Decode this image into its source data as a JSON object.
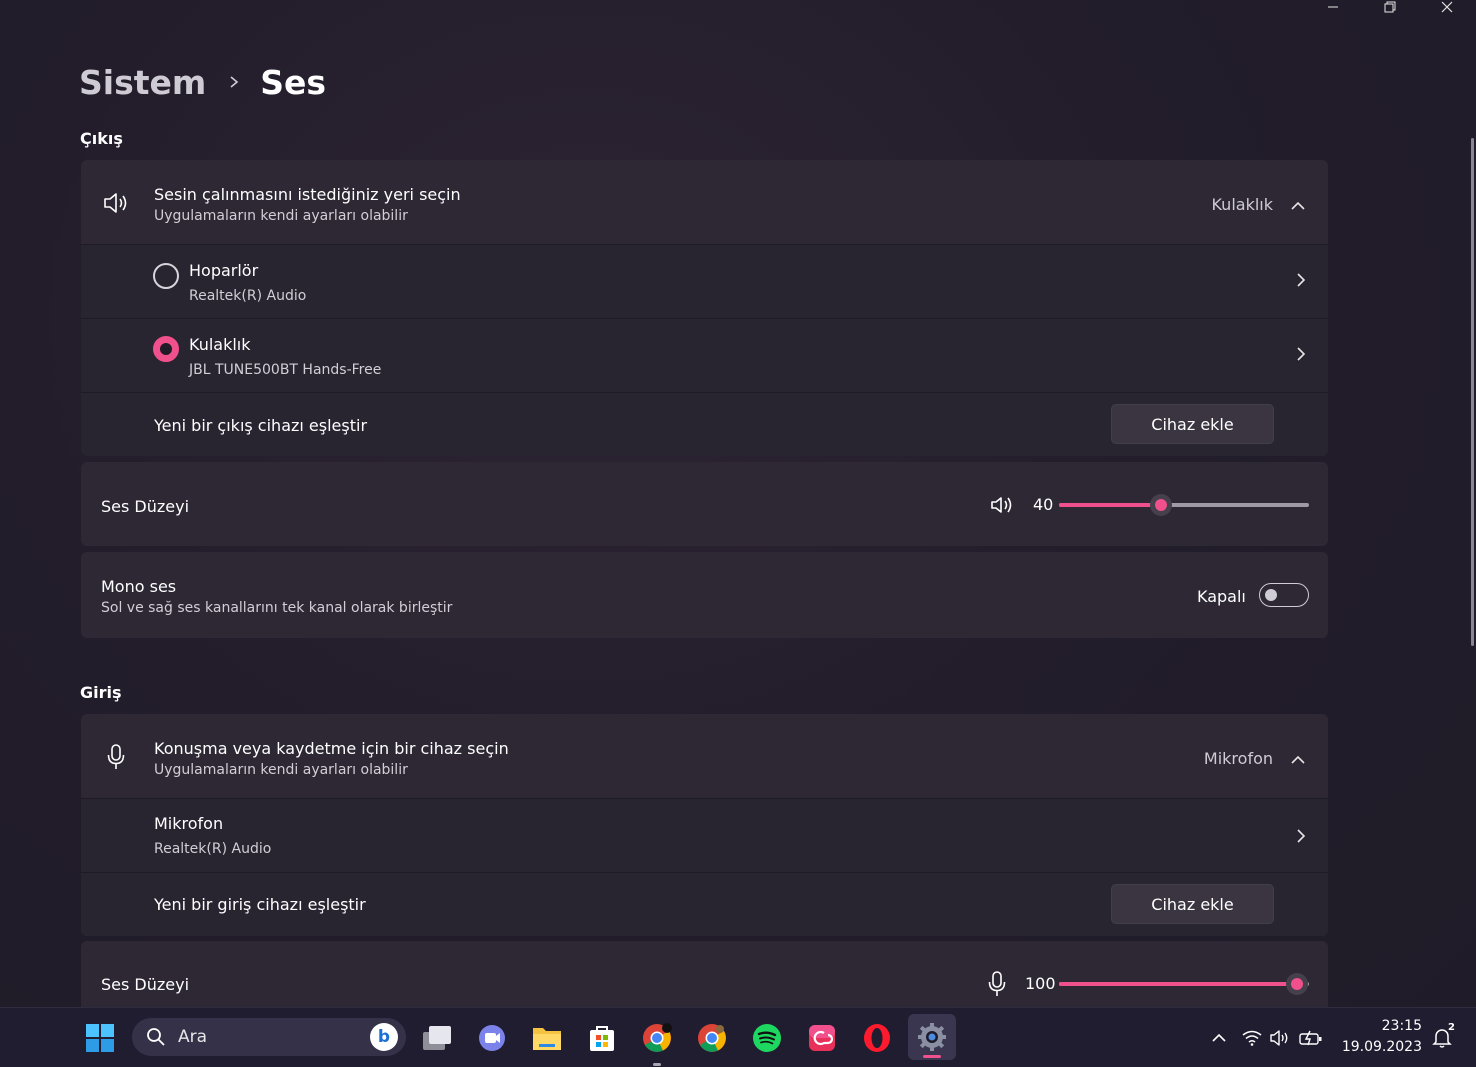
{
  "window": {
    "controls": [
      "minimize-icon",
      "restore-icon",
      "close-icon"
    ]
  },
  "breadcrumb": {
    "parent": "Sistem",
    "current": "Ses"
  },
  "output": {
    "section_title": "Çıkış",
    "selector": {
      "title": "Sesin çalınmasını istediğiniz yeri seçin",
      "subtitle": "Uygulamaların kendi ayarları olabilir",
      "selected_value": "Kulaklık"
    },
    "devices": [
      {
        "name": "Hoparlör",
        "detail": "Realtek(R) Audio",
        "selected": false
      },
      {
        "name": "Kulaklık",
        "detail": "JBL TUNE500BT Hands-Free",
        "selected": true
      }
    ],
    "pair": {
      "label": "Yeni bir çıkış cihazı eşleştir",
      "button": "Cihaz ekle"
    },
    "volume": {
      "label": "Ses Düzeyi",
      "value_text": "40",
      "value": 40
    },
    "mono": {
      "title": "Mono ses",
      "subtitle": "Sol ve sağ ses kanallarını tek kanal olarak birleştir",
      "state_label": "Kapalı",
      "on": false
    }
  },
  "input": {
    "section_title": "Giriş",
    "selector": {
      "title": "Konuşma veya kaydetme için bir cihaz seçin",
      "subtitle": "Uygulamaların kendi ayarları olabilir",
      "selected_value": "Mikrofon"
    },
    "devices": [
      {
        "name": "Mikrofon",
        "detail": "Realtek(R) Audio"
      }
    ],
    "pair": {
      "label": "Yeni bir giriş cihazı eşleştir",
      "button": "Cihaz ekle"
    },
    "volume": {
      "label": "Ses Düzeyi",
      "value_text": "100",
      "value": 100
    }
  },
  "taskbar": {
    "search_placeholder": "Ara",
    "apps": [
      "start-icon",
      "task-view-icon",
      "chat-icon",
      "file-explorer-icon",
      "store-icon",
      "chrome-icon",
      "chrome-profile-icon",
      "spotify-icon",
      "creative-cloud-icon",
      "opera-icon",
      "settings-icon"
    ],
    "time": "23:15",
    "date": "19.09.2023",
    "notification_count": "2"
  },
  "colors": {
    "accent": "#f0508c",
    "background": "#231d2b",
    "card": "#2d2834",
    "taskbar": "#201d31"
  }
}
